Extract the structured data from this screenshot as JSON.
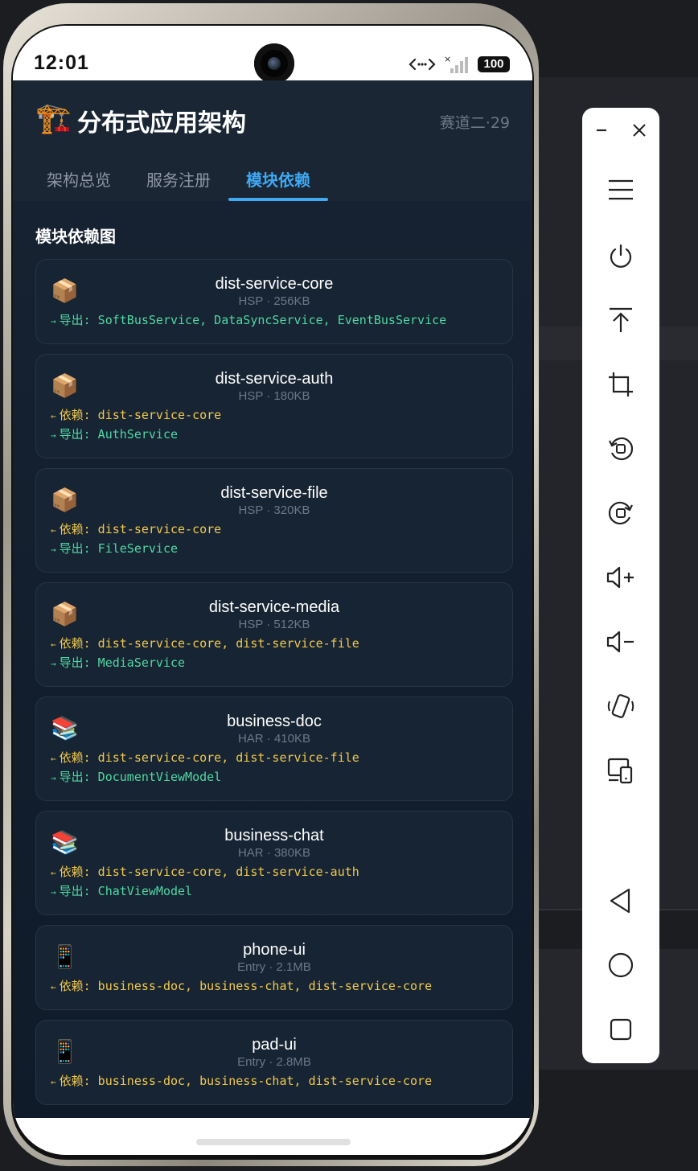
{
  "status_bar": {
    "time": "12:01",
    "battery": "100"
  },
  "app": {
    "logo_icon": "🏗️",
    "title": "分布式应用架构",
    "subtitle": "赛道二·29",
    "tabs": [
      {
        "label": "架构总览",
        "active": false
      },
      {
        "label": "服务注册",
        "active": false
      },
      {
        "label": "模块依赖",
        "active": true
      }
    ],
    "section_title": "模块依赖图",
    "modules": [
      {
        "icon": "📦",
        "name": "dist-service-core",
        "meta": "HSP · 256KB",
        "lines": [
          {
            "kind": "exp",
            "arrow": "→",
            "text": "导出: SoftBusService, DataSyncService, EventBusService"
          }
        ]
      },
      {
        "icon": "📦",
        "name": "dist-service-auth",
        "meta": "HSP · 180KB",
        "lines": [
          {
            "kind": "dep",
            "arrow": "←",
            "text": "依赖: dist-service-core"
          },
          {
            "kind": "exp",
            "arrow": "→",
            "text": "导出: AuthService"
          }
        ]
      },
      {
        "icon": "📦",
        "name": "dist-service-file",
        "meta": "HSP · 320KB",
        "lines": [
          {
            "kind": "dep",
            "arrow": "←",
            "text": "依赖: dist-service-core"
          },
          {
            "kind": "exp",
            "arrow": "→",
            "text": "导出: FileService"
          }
        ]
      },
      {
        "icon": "📦",
        "name": "dist-service-media",
        "meta": "HSP · 512KB",
        "lines": [
          {
            "kind": "dep",
            "arrow": "←",
            "text": "依赖: dist-service-core, dist-service-file"
          },
          {
            "kind": "exp",
            "arrow": "→",
            "text": "导出: MediaService"
          }
        ]
      },
      {
        "icon": "📚",
        "name": "business-doc",
        "meta": "HAR · 410KB",
        "lines": [
          {
            "kind": "dep",
            "arrow": "←",
            "text": "依赖: dist-service-core, dist-service-file"
          },
          {
            "kind": "exp",
            "arrow": "→",
            "text": "导出: DocumentViewModel"
          }
        ]
      },
      {
        "icon": "📚",
        "name": "business-chat",
        "meta": "HAR · 380KB",
        "lines": [
          {
            "kind": "dep",
            "arrow": "←",
            "text": "依赖: dist-service-core, dist-service-auth"
          },
          {
            "kind": "exp",
            "arrow": "→",
            "text": "导出: ChatViewModel"
          }
        ]
      },
      {
        "icon": "📱",
        "name": "phone-ui",
        "meta": "Entry · 2.1MB",
        "lines": [
          {
            "kind": "dep",
            "arrow": "←",
            "text": "依赖: business-doc, business-chat, dist-service-core"
          }
        ]
      },
      {
        "icon": "📱",
        "name": "pad-ui",
        "meta": "Entry · 2.8MB",
        "lines": [
          {
            "kind": "dep",
            "arrow": "←",
            "text": "依赖: business-doc, business-chat, dist-service-core"
          }
        ]
      }
    ]
  },
  "toolbar": {
    "buttons": [
      "minimize-icon",
      "close-icon",
      "menu-icon",
      "power-icon",
      "pin-top-icon",
      "crop-icon",
      "rotate-left-icon",
      "rotate-right-icon",
      "volume-up-icon",
      "volume-down-icon",
      "shake-icon",
      "multi-device-icon",
      "back-icon",
      "home-icon",
      "recents-icon"
    ]
  },
  "colors": {
    "accent": "#3fa9f5",
    "dependency": "#f2c94c",
    "export": "#4fd8a3",
    "card_bg": "#172433"
  }
}
